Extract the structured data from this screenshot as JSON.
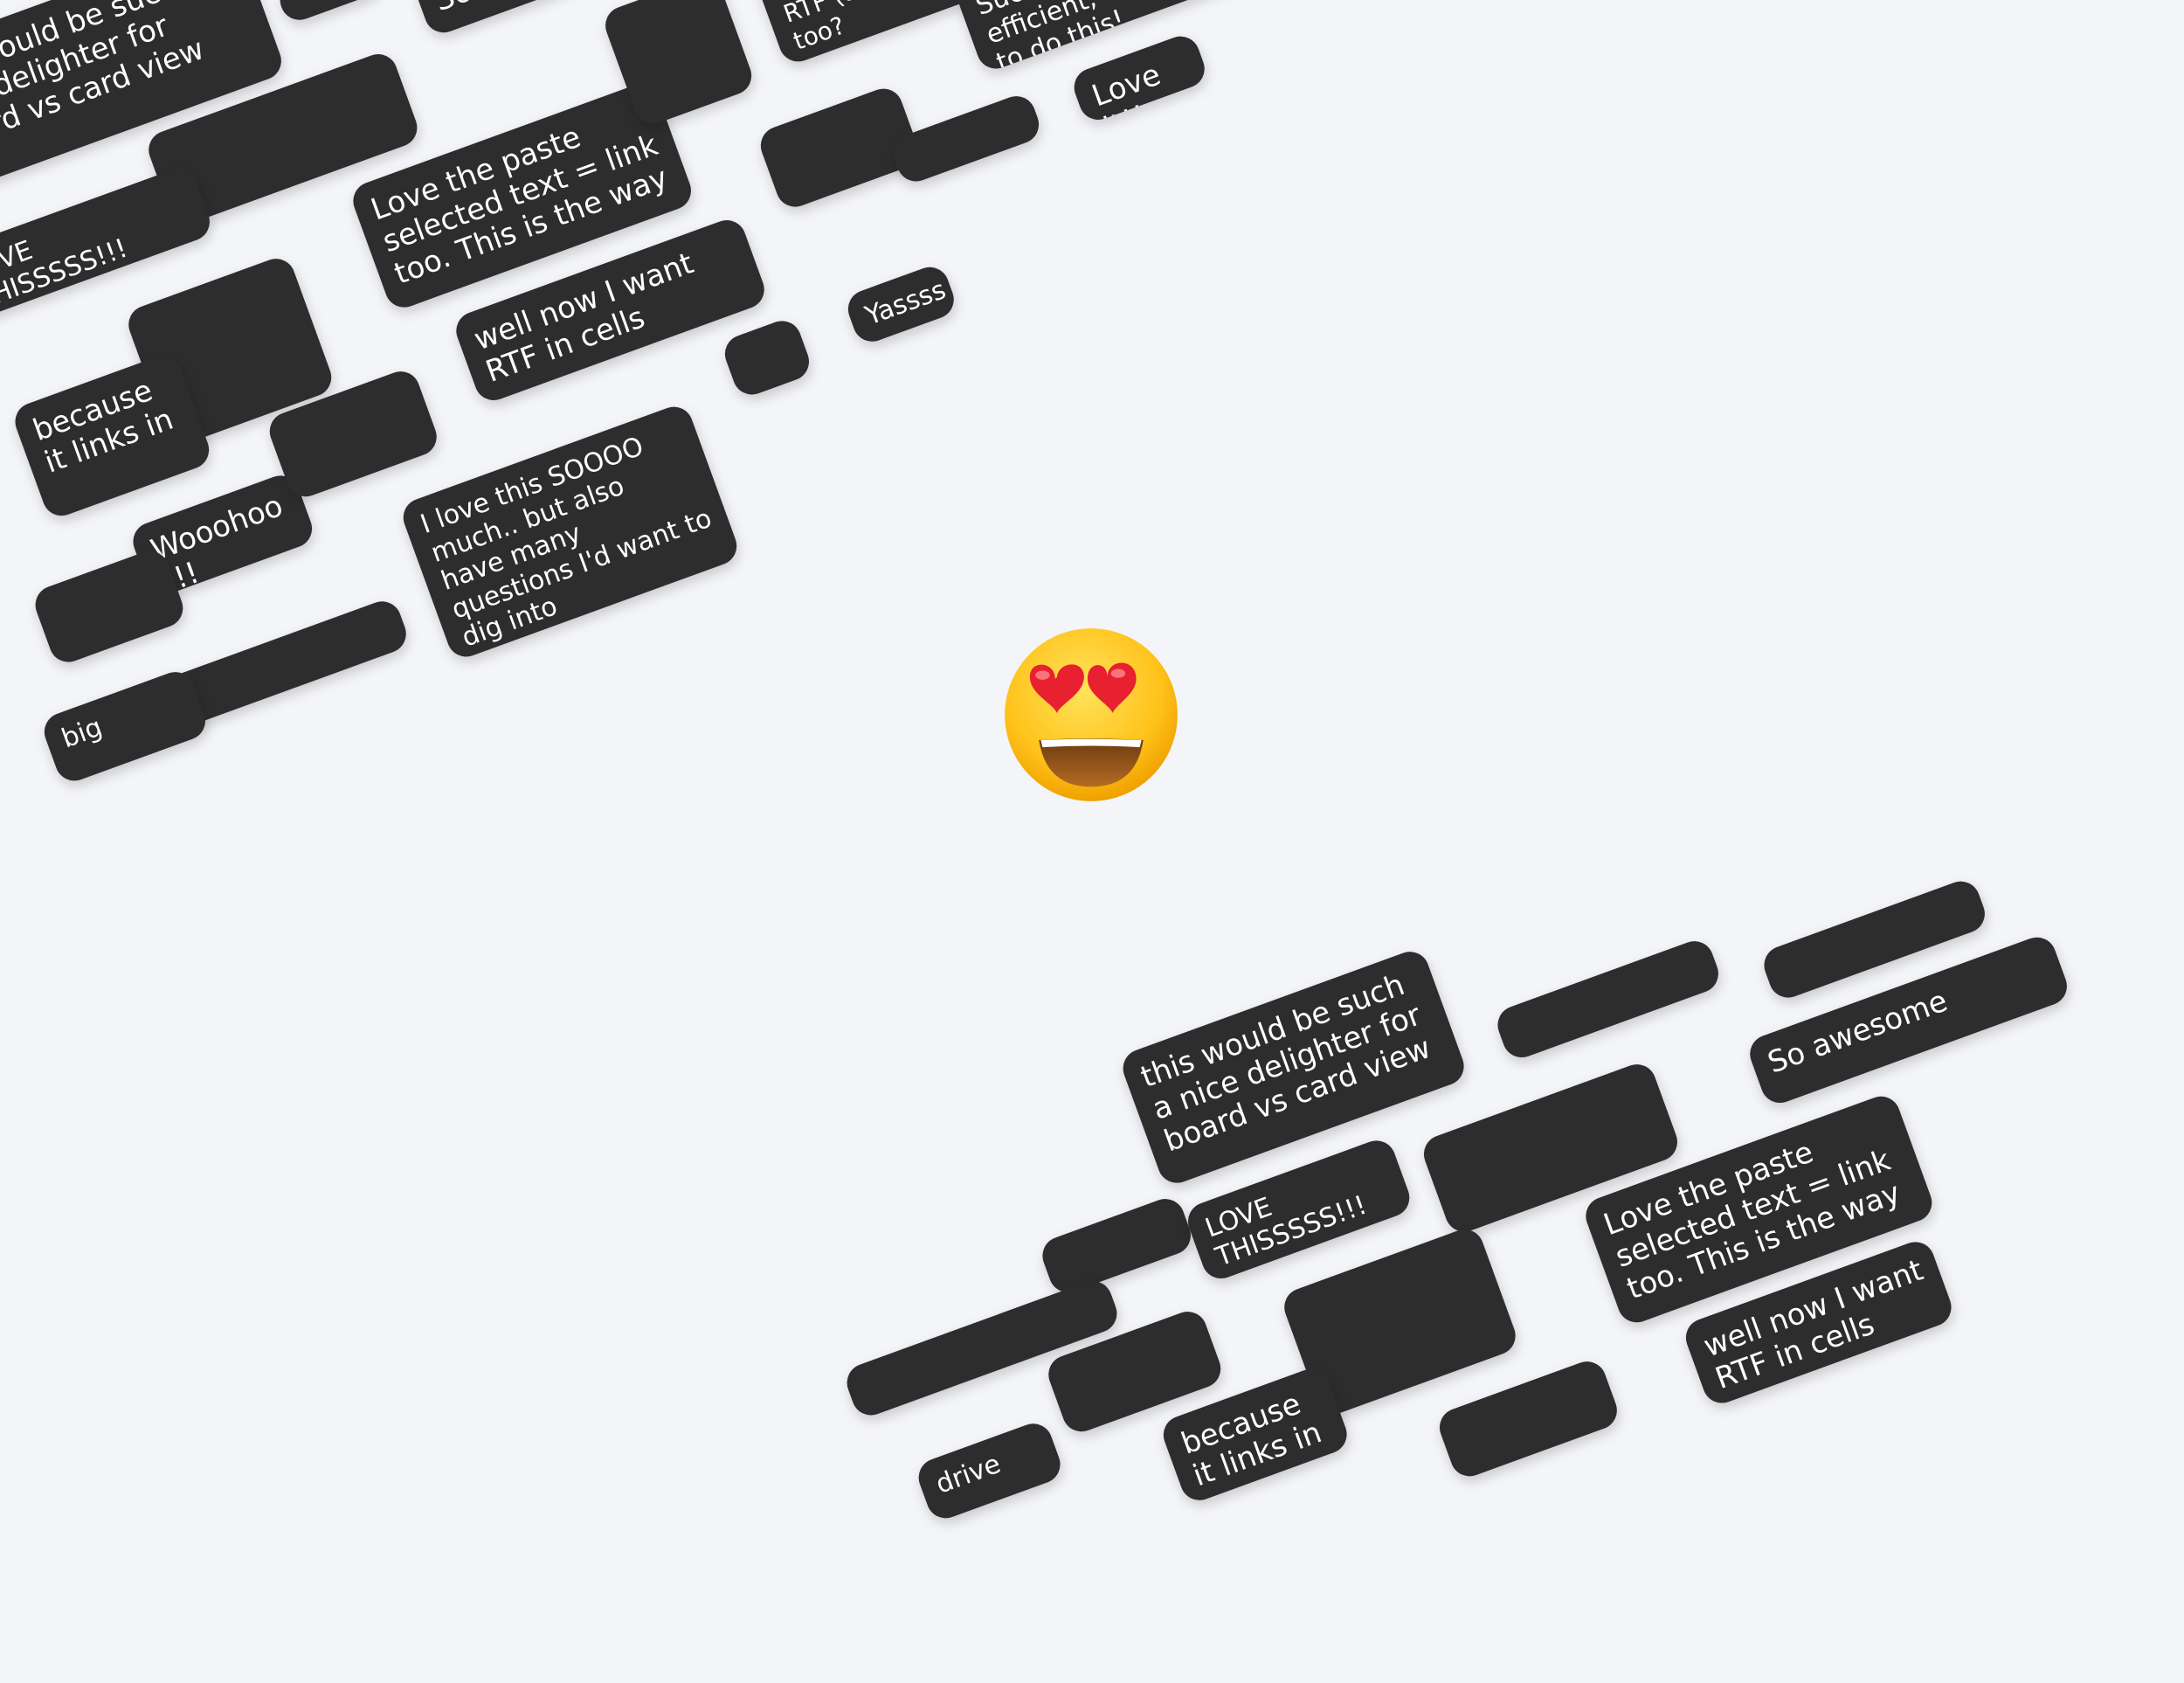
{
  "colors": {
    "background": "#f4f5f9",
    "bubble": "#2d2d2d",
    "bubble_text": "#ffffff"
  },
  "center_icon": "heart-eyes-emoji",
  "top_cluster": {
    "feedback": {
      "board_view": "this would be such a nice delighter for board vs card view",
      "so_awesome": "So awesome",
      "rtf_support": "Would also love support to get more RTF (and BULLETS!!) too?",
      "efficient": "Such a more efficient, clean way to do this!",
      "love_this": "LOVE THISSSSS!!!",
      "paste_link": "Love the paste selected text = link too.  This is the way",
      "love_it": "Love it!!",
      "because_links": "because it links in",
      "rtf_cells": "well now I want RTF in cells",
      "yassss": "Yassss",
      "wooohoo": "Wooohoo !!!",
      "questions": "I love this SOOOO much.. but also have many questions I'd want to dig into",
      "big": "big"
    }
  },
  "bottom_cluster": {
    "feedback": {
      "board_view": "this would be such a nice delighter for board vs card view",
      "so_awesome": "So awesome",
      "love_this": "LOVE THISSSSS!!!",
      "paste_link": "Love the paste selected text = link too.  This is the way",
      "rtf_cells": "well now I want RTF in cells",
      "drive": "drive",
      "because_links": "because it links in"
    }
  }
}
